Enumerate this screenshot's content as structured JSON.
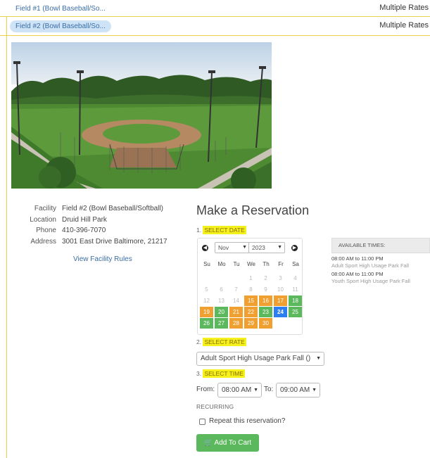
{
  "fields": [
    {
      "name": "Field #1 (Bowl Baseball/So...",
      "rate": "Multiple Rates"
    },
    {
      "name": "Field #2 (Bowl Baseball/So...",
      "rate": "Multiple Rates"
    }
  ],
  "facility": {
    "rows": [
      {
        "label": "Facility",
        "value": "Field #2 (Bowl Baseball/Softball)"
      },
      {
        "label": "Location",
        "value": "Druid Hill Park"
      },
      {
        "label": "Phone",
        "value": "410-396-7070"
      },
      {
        "label": "Address",
        "value": "3001 East Drive Baltimore, 21217"
      }
    ],
    "rules_link": "View Facility Rules"
  },
  "reservation": {
    "title": "Make a Reservation",
    "step1_num": "1.",
    "step1": "SELECT DATE",
    "step2_num": "2.",
    "step2": "SELECT RATE",
    "step3_num": "3.",
    "step3": "SELECT TIME",
    "calendar": {
      "month": "Nov",
      "year": "2023",
      "weekdays": [
        "Su",
        "Mo",
        "Tu",
        "We",
        "Th",
        "Fr",
        "Sa"
      ],
      "selected_day": "24"
    },
    "rate_select": "Adult Sport High Usage Park Fall ()",
    "from_label": "From:",
    "from_value": "08:00 AM",
    "to_label": "To:",
    "to_value": "09:00 AM",
    "recurring_label": "RECURRING",
    "repeat_label": "Repeat this reservation?",
    "cart_button": "Add To Cart"
  },
  "available": {
    "header": "AVAILABLE TIMES:",
    "slots": [
      {
        "time": "08:00 AM to 11:00 PM",
        "rate": "Adult Sport High Usage Park Fall"
      },
      {
        "time": "08:00 AM to 11:00 PM",
        "rate": "Youth Sport High Usage Park Fall"
      }
    ]
  },
  "colors": {
    "highlight": "#f4f11c",
    "available_orange": "#f0a030",
    "available_green": "#5cb85c",
    "selected_blue": "#2d7ff0",
    "link_blue": "#3b6ea5"
  }
}
